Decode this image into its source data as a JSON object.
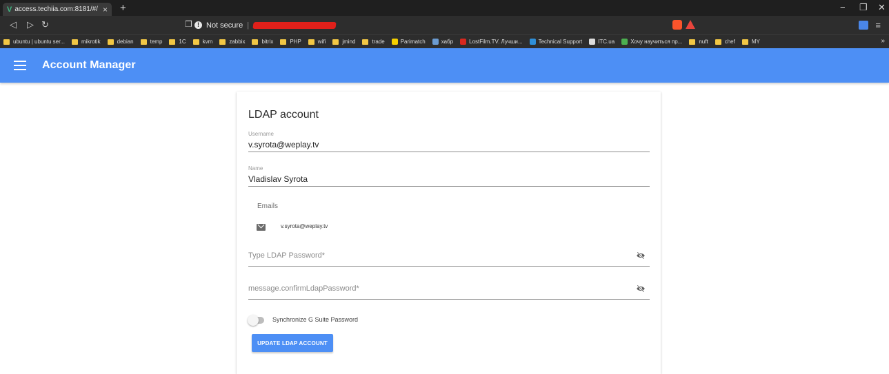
{
  "browser": {
    "tab_title": "access.techiia.com:8181/#/",
    "tab_close": "×",
    "new_tab": "+",
    "security_label": "Not secure",
    "bookmarks": [
      {
        "label": "ubuntu | ubuntu ser...",
        "kind": "folder"
      },
      {
        "label": "mikrotik",
        "kind": "folder"
      },
      {
        "label": "debian",
        "kind": "folder"
      },
      {
        "label": "temp",
        "kind": "folder"
      },
      {
        "label": "1C",
        "kind": "folder"
      },
      {
        "label": "kvm",
        "kind": "folder"
      },
      {
        "label": "zabbix",
        "kind": "folder"
      },
      {
        "label": "bitrix",
        "kind": "folder"
      },
      {
        "label": "PHP",
        "kind": "folder"
      },
      {
        "label": "wifi",
        "kind": "folder"
      },
      {
        "label": "jmind",
        "kind": "folder"
      },
      {
        "label": "trade",
        "kind": "folder"
      },
      {
        "label": "Parimatch",
        "kind": "site",
        "color": "#f5d000"
      },
      {
        "label": "хабр",
        "kind": "site",
        "color": "#6b9bd1"
      },
      {
        "label": "LostFilm.TV. Лучши...",
        "kind": "site",
        "color": "#d7281f"
      },
      {
        "label": "Technical Support",
        "kind": "site",
        "color": "#2f8fd8"
      },
      {
        "label": "ITC.ua",
        "kind": "site",
        "color": "#dcdcdc"
      },
      {
        "label": "Хочу научиться пр...",
        "kind": "site",
        "color": "#4caf50"
      },
      {
        "label": "nuft",
        "kind": "folder"
      },
      {
        "label": "chef",
        "kind": "folder"
      },
      {
        "label": "MY",
        "kind": "folder"
      }
    ],
    "bookmarks_more": "»"
  },
  "app": {
    "title": "Account Manager",
    "accent_color": "#4d8ff5"
  },
  "form": {
    "title": "LDAP account",
    "username_label": "Username",
    "username_value": "v.syrota@weplay.tv",
    "name_label": "Name",
    "name_value": "Vladislav Syrota",
    "emails_label": "Emails",
    "emails": [
      "v.syrota@weplay.tv"
    ],
    "password_placeholder": "Type LDAP Password*",
    "confirm_placeholder": "message.confirmLdapPassword*",
    "sync_label": "Synchronize G Suite Password",
    "sync_enabled": false,
    "submit_label": "UPDATE LDAP ACCOUNT"
  },
  "icons": {
    "menu": "menu-icon",
    "mail": "mail-icon",
    "visibility_off": "eye-off-icon"
  }
}
